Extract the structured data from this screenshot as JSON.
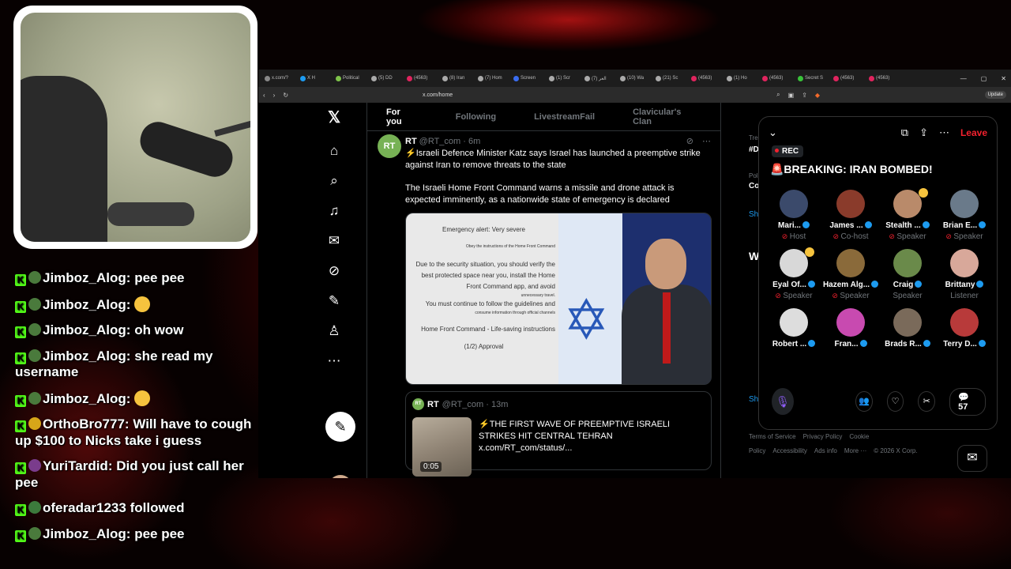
{
  "chat": [
    {
      "user": "Jimboz_Alog",
      "text": "pee pee",
      "avatar_color": "#4a7a3c",
      "emoji": false
    },
    {
      "user": "Jimboz_Alog",
      "text": "",
      "avatar_color": "#4a7a3c",
      "emoji": true
    },
    {
      "user": "Jimboz_Alog",
      "text": "oh wow",
      "avatar_color": "#4a7a3c",
      "emoji": false
    },
    {
      "user": "Jimboz_Alog",
      "text": "she read my username",
      "avatar_color": "#4a7a3c",
      "emoji": false
    },
    {
      "user": "Jimboz_Alog",
      "text": "",
      "avatar_color": "#4a7a3c",
      "emoji": true
    },
    {
      "user": "OrthoBro777",
      "text": "Will have to cough up $100 to Nicks take i guess",
      "avatar_color": "#d7a619",
      "emoji": false
    },
    {
      "user": "YuriTardid",
      "text": "Did you just call her pee",
      "avatar_color": "#7a3c8c",
      "emoji": false
    },
    {
      "user": "oferadar1233",
      "text": "followed",
      "avatar_color": "#3c7a3c",
      "emoji": false,
      "system": true
    },
    {
      "user": "Jimboz_Alog",
      "text": "pee pee",
      "avatar_color": "#4a7a3c",
      "emoji": false
    }
  ],
  "browser": {
    "tabs": [
      "x.com/?",
      "X H",
      "Political",
      "(5) DD",
      "(4563)",
      "(8) Iran",
      "(7) Hom",
      "Screen",
      "(1) Scr",
      "العر (7)",
      "(10) Wa",
      "(21) Sc",
      "(4563)",
      "(1) Ho",
      "(4563)",
      "Secret S",
      "(4563)",
      "(4563)"
    ],
    "url": "x.com/home",
    "update": "Update"
  },
  "feed": {
    "tabs": [
      "For you",
      "Following",
      "LivestreamFail",
      "Clavicular's Clan"
    ],
    "tweet": {
      "avatar": "RT",
      "name": "RT",
      "handle": "@RT_com · 6m",
      "text1": "⚡Israeli Defence Minister Katz says Israel has launched a preemptive strike against Iran to remove threats to the state",
      "text2": "The Israeli Home Front Command warns a missile and drone attack is expected imminently, as a nationwide state of emergency is declared",
      "media_alert": "Emergency alert: Very severe",
      "media_small1": "Obey the instructions of the Home Front Command",
      "media_body": "Due to the security situation, you should verify the best protected space near you, install the Home Front Command app, and avoid",
      "media_small2": "unnecessary travel.",
      "media_body2": "You must continue to follow the guidelines and",
      "media_small3": "consume information through official channels",
      "media_footer": "Home Front Command - Life-saving instructions",
      "media_page": "(1/2) Approval"
    },
    "quote": {
      "avatar": "RT",
      "name": "RT",
      "handle": "@RT_com · 13m",
      "text": "⚡THE FIRST WAVE OF PREEMPTIVE ISRAELI STRIKES HIT CENTRAL TEHRAN  x.com/RT_com/status/...",
      "duration": "0:05"
    }
  },
  "right": {
    "frag1": "Tre",
    "frag2": "#D",
    "frag3": "Poli",
    "frag4": "Co",
    "frag5": "Sh",
    "frag6": "W",
    "frag7": "Sh",
    "footer": [
      "Terms of Service",
      "Privacy Policy",
      "Cookie Policy",
      "Accessibility",
      "Ads info",
      "More ···",
      "© 2026 X Corp."
    ]
  },
  "space": {
    "rec": "REC",
    "leave": "Leave",
    "title": "🚨BREAKING: IRAN BOMBED!",
    "participants": [
      {
        "name": "Mari...",
        "role": "Host",
        "color": "#3b4a6b",
        "muted": true
      },
      {
        "name": "James ...",
        "role": "Co-host",
        "color": "#8a3b2b",
        "muted": true
      },
      {
        "name": "Stealth ...",
        "role": "Speaker",
        "color": "#b98a6a",
        "muted": true,
        "wave": true
      },
      {
        "name": "Brian E...",
        "role": "Speaker",
        "color": "#6a7a8a",
        "muted": true
      },
      {
        "name": "Eyal Of...",
        "role": "Speaker",
        "color": "#d8d8d8",
        "muted": true,
        "wave": true
      },
      {
        "name": "Hazem Alg...",
        "role": "Speaker",
        "color": "#8a6a3a",
        "muted": true
      },
      {
        "name": "Craig",
        "role": "Speaker",
        "color": "#6a8a4a",
        "muted": false
      },
      {
        "name": "Brittany",
        "role": "Listener",
        "color": "#d8a89a",
        "muted": false
      },
      {
        "name": "Robert ...",
        "role": "",
        "color": "#dddddd",
        "muted": false
      },
      {
        "name": "Fran...",
        "role": "",
        "color": "#c84ab0",
        "muted": false
      },
      {
        "name": "Brads R...",
        "role": "",
        "color": "#7a6a5a",
        "muted": false
      },
      {
        "name": "Terry D...",
        "role": "",
        "color": "#b83a3a",
        "muted": false
      }
    ],
    "comments": "57"
  },
  "colors": {
    "accent": "#1d9bf0",
    "leave": "#f4212e",
    "kick_green": "#53fc18"
  }
}
